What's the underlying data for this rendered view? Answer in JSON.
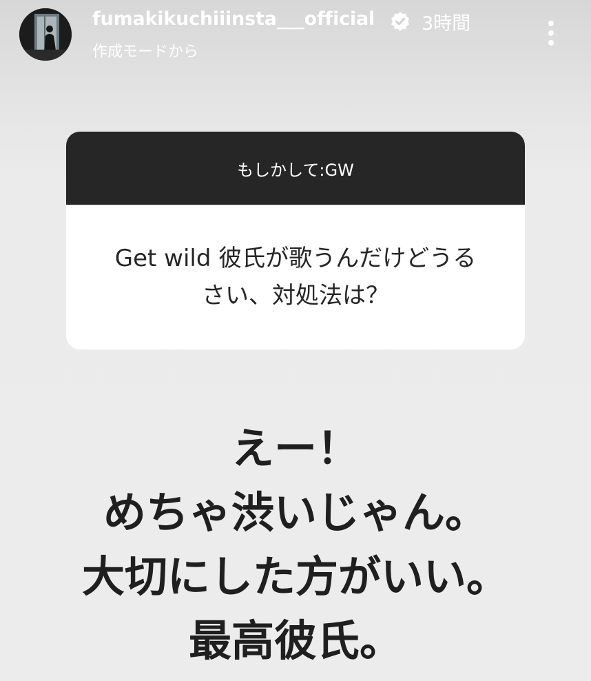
{
  "header": {
    "username": "fumakikuchiiinsta___official",
    "timestamp": "3時間",
    "subtitle": "作成モードから",
    "verified_icon": "verified-badge-icon",
    "more_icon": "more-vertical-icon"
  },
  "question": {
    "prompt": "もしかして:GW",
    "text": "Get wild 彼氏が歌うんだけどうるさい、対処法は？"
  },
  "reply": {
    "lines": [
      "えー！",
      "めちゃ渋いじゃん。",
      "大切にした方がいい。",
      "最高彼氏。"
    ]
  },
  "colors": {
    "card_header": "#262626",
    "card_body": "#ffffff",
    "background": "#ebebeb",
    "reply_text": "#1f1f1f"
  }
}
